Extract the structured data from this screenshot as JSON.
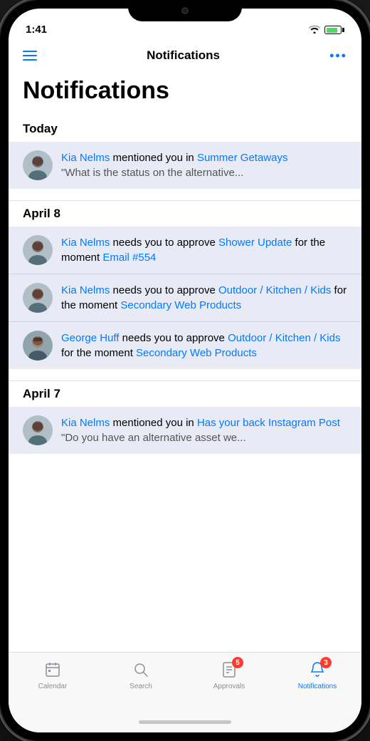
{
  "statusBar": {
    "time": "1:41",
    "wifi": "wifi",
    "battery": 80
  },
  "navBar": {
    "title": "Notifications",
    "moreLabel": "•••"
  },
  "pageTitle": "Notifications",
  "sections": [
    {
      "id": "today",
      "label": "Today",
      "items": [
        {
          "id": "notif-1",
          "avatarType": "woman1",
          "text": " mentioned you in ",
          "sender": "Kia Nelms",
          "link": "Summer Getaways",
          "preview": "\"What is the status on the alternative..."
        }
      ]
    },
    {
      "id": "april8",
      "label": "April 8",
      "items": [
        {
          "id": "notif-2",
          "avatarType": "woman1",
          "text": " needs you to approve ",
          "sender": "Kia Nelms",
          "link": "Shower Update",
          "suffix": " for the moment ",
          "link2": "Email #554"
        },
        {
          "id": "notif-3",
          "avatarType": "woman1",
          "text": " needs you to approve ",
          "sender": "Kia Nelms",
          "link": "Outdoor / Kitchen / Kids",
          "suffix": " for the moment ",
          "link2": "Secondary Web Products"
        },
        {
          "id": "notif-4",
          "avatarType": "man1",
          "text": " needs you to approve ",
          "sender": "George Huff",
          "link": "Outdoor / Kitchen / Kids",
          "suffix": " for the moment ",
          "link2": "Secondary Web Products"
        }
      ]
    },
    {
      "id": "april7",
      "label": "April 7",
      "items": [
        {
          "id": "notif-5",
          "avatarType": "woman1",
          "text": " mentioned you in ",
          "sender": "Kia Nelms",
          "link": "Has your back Instagram Post",
          "preview": "\"Do you have an alternative asset we..."
        }
      ]
    }
  ],
  "tabs": [
    {
      "id": "calendar",
      "label": "Calendar",
      "icon": "calendar",
      "badge": null,
      "active": false
    },
    {
      "id": "search",
      "label": "Search",
      "icon": "search",
      "badge": null,
      "active": false
    },
    {
      "id": "approvals",
      "label": "Approvals",
      "icon": "approvals",
      "badge": "5",
      "active": false
    },
    {
      "id": "notifications",
      "label": "Notifications",
      "icon": "bell",
      "badge": "3",
      "active": true
    }
  ],
  "colors": {
    "accent": "#007aff",
    "notifBg": "#e8eaf6",
    "activeTab": "#007aff",
    "inactiveTab": "#8e8e93"
  }
}
